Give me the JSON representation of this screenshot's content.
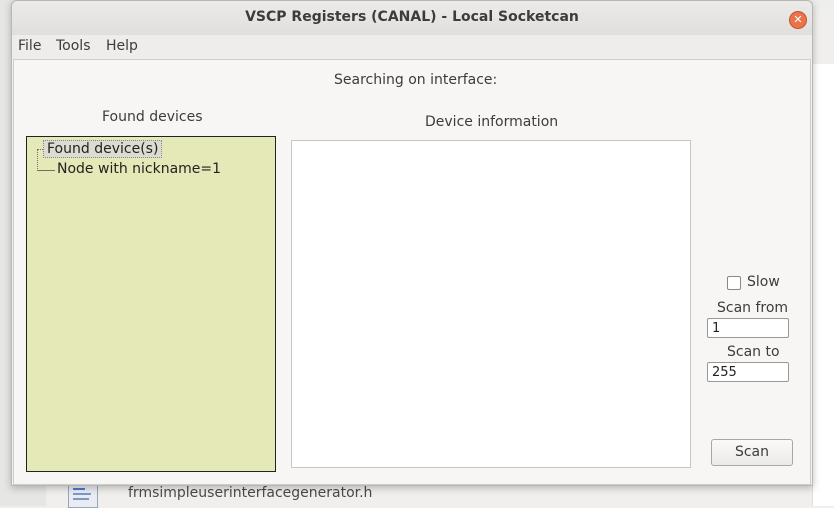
{
  "window": {
    "title": "VSCP Registers (CANAL) - Local Socketcan",
    "close_symbol": "✕"
  },
  "menu": [
    "File",
    "Tools",
    "Help"
  ],
  "search_status": "Searching on interface:",
  "found_devices": {
    "label": "Found devices",
    "tree": {
      "root": "Found device(s)",
      "children": [
        "Node with nickname=1"
      ]
    }
  },
  "device_information": {
    "label": "Device information",
    "content": ""
  },
  "scan_options": {
    "slow_label": "Slow",
    "slow_checked": false,
    "scan_from_label": "Scan from",
    "scan_from_value": "1",
    "scan_to_label": "Scan to",
    "scan_to_value": "255",
    "scan_button": "Scan"
  },
  "background": {
    "file_name": "frmsimpleuserinterfacegenerator.h"
  }
}
